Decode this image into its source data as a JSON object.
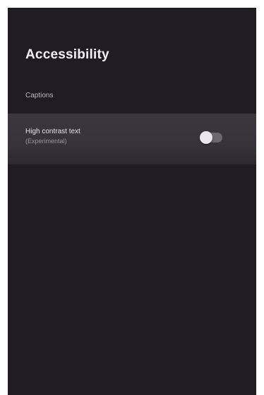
{
  "panel": {
    "title": "Accessibility"
  },
  "menu": {
    "items": [
      {
        "label": "Captions"
      },
      {
        "label": "High contrast text",
        "sublabel": "(Experimental)",
        "toggle_on": false
      }
    ]
  },
  "colors": {
    "background": "#1f1c22",
    "focused_row": "#36333a",
    "toggle_track": "#6b676f",
    "toggle_thumb": "#e9e7eb"
  }
}
